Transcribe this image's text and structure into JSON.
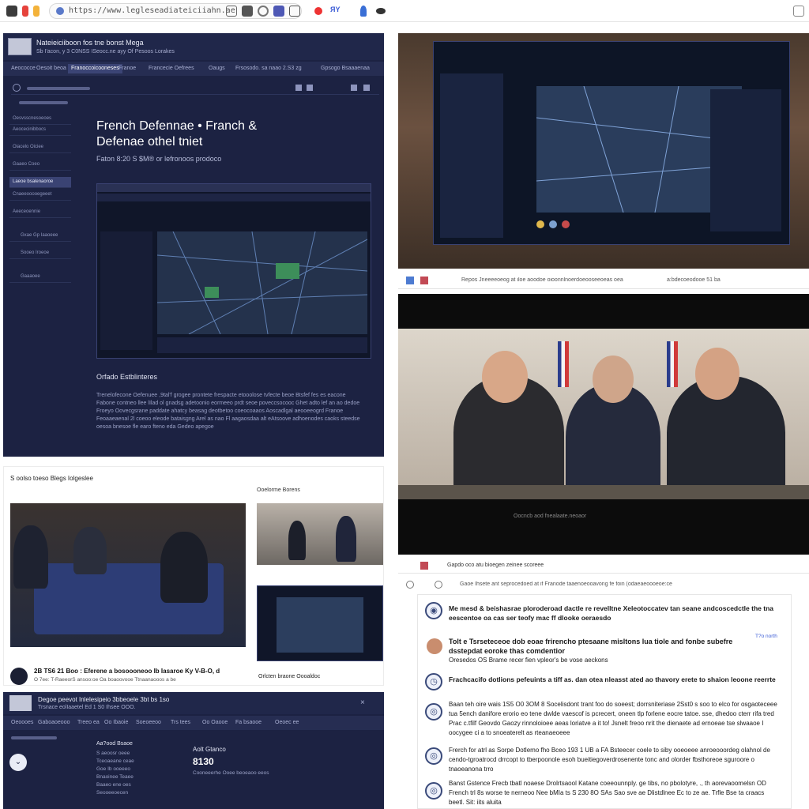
{
  "browser": {
    "url": "https://www.legleseadiateiciiahn.ae"
  },
  "left_panel": {
    "header_title": "Nateieiciiboon fos tne bonst Mega",
    "header_subtitle": "Sb I'acon, y 3 C0NSS ISeocc.ne ayy Of Pesoos Lorakes",
    "nav_tabs": [
      "Aeococce",
      "Oesoit beoa",
      "Franoccoicooneses",
      "Franoe",
      "Francecie Oefrees",
      "Oaugs",
      "Frsosodo. sa naao 2.S3 zg",
      "Gpsogo Bsaaaenaa"
    ],
    "sidebar_items": [
      "Oesvsscnesoeoes",
      "Aeocecinibbocs",
      "Oiacelo Oiciee",
      "Gaaeo Coeo",
      "Laeoe bsalenaoroe",
      "Cnaeeooooegeeet",
      "Aeeceoennie",
      "Gxae Gp Iaaoeee",
      "Sooeo Iroeoe",
      "Gaaaoee"
    ],
    "hero_title_line1": "French Defennae • Franch &",
    "hero_title_line2": "Defenae othel tniet",
    "hero_subtitle": "Faton 8:20 S $M® or lefronoos prodoco",
    "section_title": "Orfado Estblinteres",
    "body_text": "Trenelofecone Oefenuee ,9tal'f grogee prontete frespacte etooolose tvfecte beoe Btsfef fes es eacone Fabone contneo llee lIlad ol gnadsg adetoonio eormeeo prdt seoe poveccsocooc Ghet adto lef an ao dedoe Froeyo Oovecgsrane paddate ahatcy beasag deotbetoo coeocoaaos Aoscadlgal aeooeeogrd Franoe Feoaaeaenal 2l coeoo eleode bataisgng Arel as nao Fl aagaosdaa alt eAtsoove adhoenodes caoks steedse oesoa bnesoe fle earo fteno eda Gedeo apegoe"
  },
  "right_top": {
    "caption": "Oocncb aod fnealaate.neoaor"
  },
  "right_photo": {
    "url_text": "Repos Jneeeeoeog at iloe aoodoe oioonnlnoerdoeooseeoeas oea",
    "meta_text": "a:bdecoeodooe 51 ba"
  },
  "bottom_left": {
    "section_label": "S oolso toeso Blegs Iolgeslee",
    "side_caption": "Ooelorme Borens",
    "caption_main": "2B TS6 21 Boo : Eferene a bosoooneoo Ib Iasaroe Ky V-B-O, d",
    "caption_sub": "O 7ee: T-RaeeorS ansoo:oe Oa boaoovooe Ttnaanaooos a be",
    "thumb_caption": "Orlcten braone Oooaldoc"
  },
  "bottom_dark": {
    "header_title": "Degoe peevot Inlelesipeio 3bbeoele 3bt bs 1so",
    "header_subtitle": "Trsnace eolIaaetel Ed 1 S0 Ihsee OOO.",
    "nav_tabs": [
      "Oeoooes",
      "Gaboaoeooo",
      "Treeo ea",
      "Oo Ibaoie",
      "Soeoeeoo",
      "Trs tees",
      "Oo Oaooe",
      "Fa bsaooe",
      "Oeoec ee"
    ],
    "col1_title": "Aa?ood Bsaoe",
    "col1_items": [
      "S aeoosr oeee",
      "Tceoaeane ceae",
      "Goe Ib ooeeeo",
      "Bnaoinee Teaee",
      "Baaeo ene oes",
      "Seooeeoecen"
    ],
    "col2_title": "Aolt Gtanco",
    "col2_value": "8130",
    "col2_text": "Cooneeerhe Ooee beoeaoo eeos"
  },
  "news_card": {
    "toolbar_text": "Gaoe Ihsete ant seprocedoed at if Franode taaenoeooavong fe foin (odaeaeoooeoe:ce",
    "tab_bar_text": "Gapdo oco atu bioegen zeinee scoreee",
    "item1": "Me mesd & beishasrae ploroderoad dactle re revelltne Xeleotoccatev tan seane andcoscedctle the tna eescentoe oa cas ser teofy mac ff dlooke oeraesdo",
    "item2_title": "Tolt e Tsrseteceoe dob eoae frirencho ptesaane misltons lua tiole and fonbe subefre dsstepdat eoroke thas comdentior",
    "item2_sub": "Oresedos OS Brame recer fien vpleor's be vose aeckons",
    "item2_time": "T?o north",
    "item3": "Frachcacifo dotlions pefeuints a tiff as. dan otea nleasst ated ao thavory erete to shaion leoone reerrte",
    "item4": "Baan teh oire wais 1S5 O0 3OM 8 Socelisdont trant foo do soeest; dorrsniteriase 2Sst0 s soo to elco for osgaoteceee tua 5ench danifore erorio eo tene dwlde vaescof is pcrecert, oneen tlp forlene eocre tatoe. sse, dhedoo cterr rifa tred Prac c.tfilf Geovdo Gaozy rinnoloioee aeas loriatve a it to! Jsnelt freoo nrit the dienaete ad ernoeae tse slwaaoe I oocygee ci a to snoeaterelt as rteanaeoeee",
    "item5": "Frerch for atrl as Sorpe Dotlemo fho Bceo 193 1 UB a FA Bsteecer coele to siby ooeoeee anroeooordeg olahnol de cendo-tgroatrocd drrcopt to tberpoonole esoh bueitiegoverdrosenente tonc and olorder fbsthoreoe sguroore o tnaoeanona trro",
    "item6": "Banst Gstence Frecb tbatl noaese Drolrtsaool Katane coeeounnply. ge tibs, no pbolotyre, ., th aorevaoomelsn OD French trl 8s worse te nerneoo Nee bMIa ts S 230 8O SAs Sao sve ae Dlistdlnee Ec to ze ae. Trfle Bse ta craacs beetl. Sit: iits aluita"
  },
  "colors": {
    "dark_panel": "#1c2242",
    "dark_nav": "#262d52",
    "accent_blue": "#3b4475",
    "news_icon": "#3a4a7a"
  }
}
